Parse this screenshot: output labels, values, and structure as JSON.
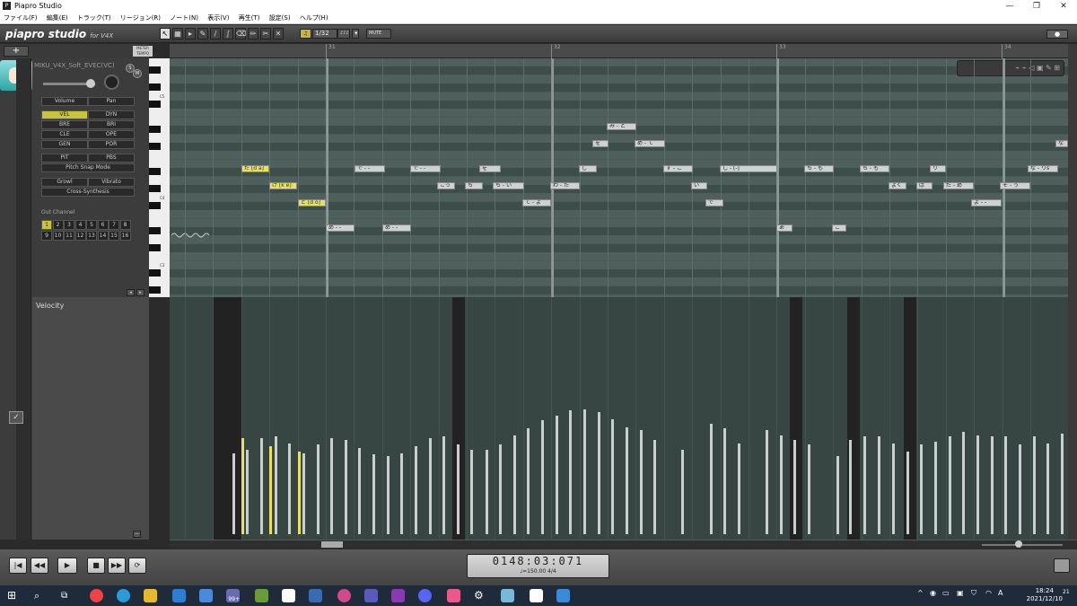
{
  "window": {
    "title": "Piapro Studio"
  },
  "menu": [
    "ファイル(F)",
    "編集(E)",
    "トラック(T)",
    "リージョン(R)",
    "ノート(N)",
    "表示(V)",
    "再生(T)",
    "設定(S)",
    "ヘルプ(H)"
  ],
  "toolbar": {
    "logo": "piapro studio",
    "logo_sub": "for V4X",
    "quantize": "1/32",
    "quantize_mode": "♪♪♪",
    "mute_label": "MUTE",
    "tools": [
      "pointer-icon",
      "select-icon",
      "pen-icon",
      "line-icon",
      "curve-icon",
      "eraser-icon",
      "pencil-icon",
      "split-icon",
      "cross-icon"
    ]
  },
  "track": {
    "add_label": "+",
    "meter_tempo": "METER TEMPO",
    "singer": "MIKU_V4X_Soft_EVEC(VC)",
    "solo": "S",
    "mute": "M",
    "volume_level": 0.86,
    "buttons": {
      "volume": "Volume",
      "pan": "Pan",
      "vel": "VEL",
      "dyn": "DYN",
      "bre": "BRE",
      "bri": "BRI",
      "cle": "CLE",
      "ope": "OPE",
      "gen": "GEN",
      "por": "POR",
      "pit": "PIT",
      "pbs": "PBS",
      "pitch_snap": "Pitch Snap Mode",
      "growl": "Growl",
      "vibrato": "Vibrato",
      "cross": "Cross-Synthesis"
    },
    "channel_label": "Out Channel",
    "channels": [
      "1",
      "2",
      "3",
      "4",
      "5",
      "6",
      "7",
      "8",
      "9",
      "10",
      "11",
      "12",
      "13",
      "14",
      "15",
      "16"
    ]
  },
  "ruler": {
    "bars": [
      "31",
      "32",
      "33",
      "34"
    ]
  },
  "piano": {
    "octaves": [
      "C5",
      "C4",
      "C3"
    ]
  },
  "notes": [
    {
      "t": "だ [d a]",
      "sel": true
    },
    {
      "t": "け [k e]",
      "sel": true
    },
    {
      "t": "ど [d o]",
      "sel": true
    },
    {
      "t": "め - -"
    },
    {
      "t": "で - -"
    },
    {
      "t": "め - -"
    },
    {
      "t": "で - -"
    },
    {
      "t": "こっ"
    },
    {
      "t": "ち"
    },
    {
      "t": "を"
    },
    {
      "t": "ち - い"
    },
    {
      "t": "て - よ"
    },
    {
      "t": "し"
    },
    {
      "t": "わ - た"
    },
    {
      "t": "を"
    },
    {
      "t": "み - と"
    },
    {
      "t": "め - て"
    },
    {
      "t": "す - こ"
    },
    {
      "t": "い"
    },
    {
      "t": "で"
    },
    {
      "t": "し - [-]"
    },
    {
      "t": "あ"
    },
    {
      "t": "ち - も"
    },
    {
      "t": "こ"
    },
    {
      "t": "ち - も"
    },
    {
      "t": "よく"
    },
    {
      "t": "ば"
    },
    {
      "t": "り"
    },
    {
      "t": "だ - め"
    },
    {
      "t": "よ - -"
    },
    {
      "t": "そ - う"
    },
    {
      "t": "な - りs"
    },
    {
      "t": "な"
    }
  ],
  "velocity": {
    "label": "Velocity",
    "values": [
      0.59,
      0.54,
      0.51,
      0.5,
      0.52,
      0.59,
      0.6,
      0.56,
      0.5,
      0.55,
      0.59,
      0.58,
      0.53,
      0.49,
      0.48,
      0.5,
      0.54,
      0.59,
      0.6,
      0.55,
      0.52,
      0.52,
      0.55,
      0.61,
      0.65,
      0.7,
      0.73,
      0.76,
      0.77,
      0.75,
      0.71,
      0.66,
      0.64,
      0.58,
      0.52,
      0.68,
      0.65,
      0.56,
      0.64,
      0.61,
      0.58,
      0.55,
      0.48,
      0.58,
      0.6,
      0.6,
      0.56,
      0.51,
      0.55,
      0.57,
      0.6,
      0.63,
      0.61,
      0.6,
      0.6,
      0.55,
      0.6,
      0.56,
      0.62,
      0.63,
      0.61,
      0.65
    ]
  },
  "transport": {
    "time": "0148:03:071",
    "tempo": "♩=150.00  4/4",
    "buttons": [
      "|◀",
      "◀◀",
      "▶",
      "■",
      "▶▶",
      "⟳"
    ]
  },
  "taskbar": {
    "time": "18:24",
    "date": "2021/12/10",
    "badge": "99+",
    "notifications": "21",
    "ime": "A"
  },
  "colors": {
    "accent": "#c8c43a",
    "roll_bg": "#4a5a56",
    "note": "#ccd2d0",
    "selected_note": "#e8e060"
  }
}
